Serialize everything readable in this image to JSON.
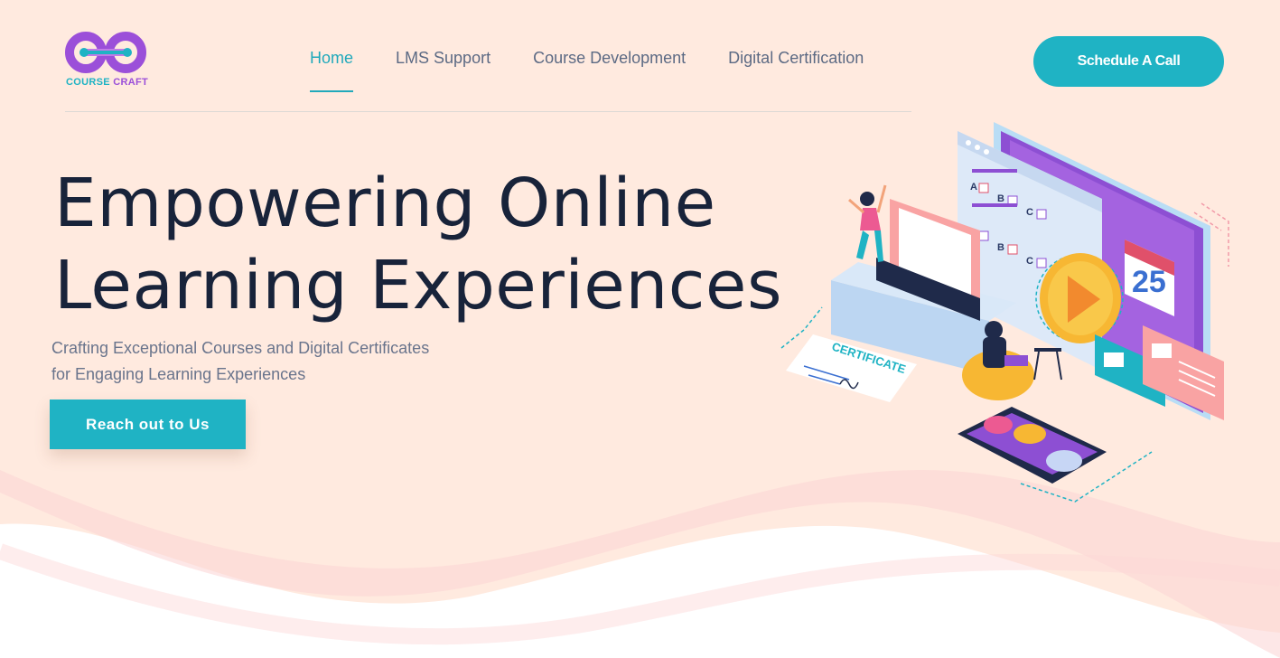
{
  "brand": {
    "name_part1": "COURSE",
    "name_part2": "CRAFT",
    "color_teal": "#1fb3c4",
    "color_purple": "#9b4fd9"
  },
  "nav": {
    "items": [
      {
        "label": "Home",
        "active": true
      },
      {
        "label": "LMS Support",
        "active": false
      },
      {
        "label": "Course Development",
        "active": false
      },
      {
        "label": "Digital Certification",
        "active": false
      }
    ]
  },
  "header": {
    "cta_label": "Schedule A Call"
  },
  "hero": {
    "title_line1": "Empowering Online",
    "title_line2": "Learning Experiences",
    "subtitle_line1": "Crafting Exceptional Courses and Digital Certificates",
    "subtitle_line2": "for Engaging Learning Experiences",
    "cta_label": "Reach out to Us"
  },
  "illustration": {
    "certificate_text": "CERTIFICATE",
    "calendar_day": "25",
    "quiz_options": [
      "A",
      "B",
      "C",
      "A",
      "B",
      "C"
    ]
  },
  "colors": {
    "background": "#ffeadf",
    "accent": "#1fb3c4",
    "heading": "#18233a",
    "nav_text": "#5c6a84"
  }
}
